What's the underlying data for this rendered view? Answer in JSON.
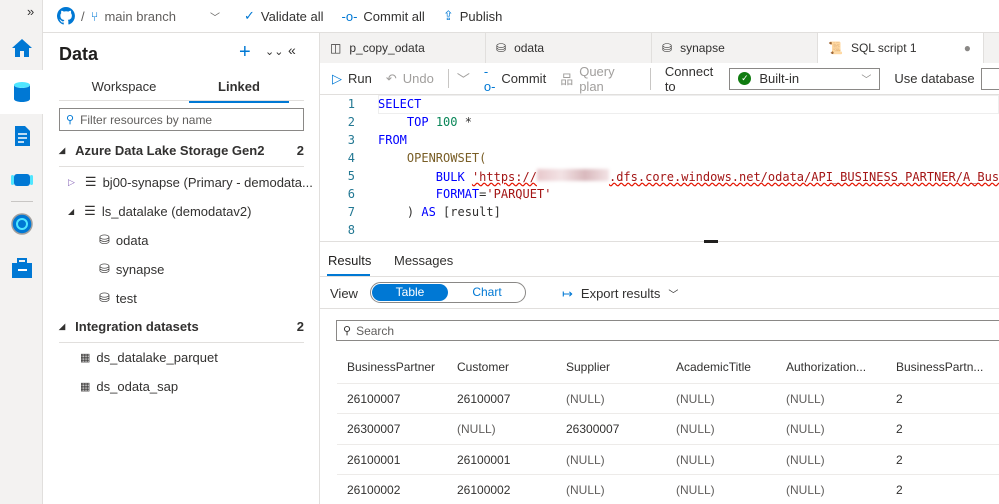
{
  "topbar": {
    "expand": "»",
    "branch": "main branch",
    "validate": "Validate all",
    "commit": "Commit all",
    "publish": "Publish"
  },
  "rail": {
    "items": [
      "home-icon",
      "data-icon",
      "develop-icon",
      "integrate-icon",
      "monitor-icon",
      "manage-icon"
    ]
  },
  "data_panel": {
    "title": "Data",
    "tabs": [
      "Workspace",
      "Linked"
    ],
    "active_tab": "Linked",
    "filter_placeholder": "Filter resources by name",
    "sections": [
      {
        "label": "Azure Data Lake Storage Gen2",
        "count": "2"
      },
      {
        "label": "Integration datasets",
        "count": "2"
      }
    ],
    "adls_items": [
      "bj00-synapse (Primary - demodata...",
      "ls_datalake (demodatav2)"
    ],
    "containers": [
      "odata",
      "synapse",
      "test"
    ],
    "datasets": [
      "ds_datalake_parquet",
      "ds_odata_sap"
    ]
  },
  "tabs": [
    {
      "label": "p_copy_odata"
    },
    {
      "label": "odata"
    },
    {
      "label": "synapse"
    },
    {
      "label": "SQL script 1",
      "active": true
    }
  ],
  "toolbar": {
    "run": "Run",
    "undo": "Undo",
    "commit": "Commit",
    "query_plan": "Query plan",
    "connect_to": "Connect to",
    "connection": "Built-in",
    "use_database": "Use database"
  },
  "editor": {
    "line_numbers": [
      "1",
      "2",
      "3",
      "4",
      "5",
      "6",
      "7",
      "8"
    ],
    "l1": "SELECT",
    "l2_kw": "TOP",
    "l2_num": "100",
    "l2_rest": " *",
    "l3": "FROM",
    "l4": "OPENROWSET(",
    "l5_kw": "BULK",
    "l5_q": "'https://",
    "l5_rest": ".dfs.core.windows.net/odata/API_BUSINESS_PARTNER/A_Business",
    "l6_kw": "FORMAT",
    "l6_eq": "=",
    "l6_str": "'PARQUET'",
    "l7_a": ") ",
    "l7_kw": "AS",
    "l7_b": " [result]"
  },
  "results": {
    "tabs": [
      "Results",
      "Messages"
    ],
    "view_label": "View",
    "view_options": [
      "Table",
      "Chart"
    ],
    "view_selected": "Table",
    "export": "Export results",
    "search_placeholder": "Search",
    "columns": [
      "BusinessPartner",
      "Customer",
      "Supplier",
      "AcademicTitle",
      "Authorization...",
      "BusinessPartn..."
    ],
    "rows": [
      [
        "26100007",
        "26100007",
        "(NULL)",
        "(NULL)",
        "(NULL)",
        "2"
      ],
      [
        "26300007",
        "(NULL)",
        "26300007",
        "(NULL)",
        "(NULL)",
        "2"
      ],
      [
        "26100001",
        "26100001",
        "(NULL)",
        "(NULL)",
        "(NULL)",
        "2"
      ],
      [
        "26100002",
        "26100002",
        "(NULL)",
        "(NULL)",
        "(NULL)",
        "2"
      ]
    ]
  },
  "colors": {
    "accent": "#0078d4",
    "ok": "#107c10"
  }
}
